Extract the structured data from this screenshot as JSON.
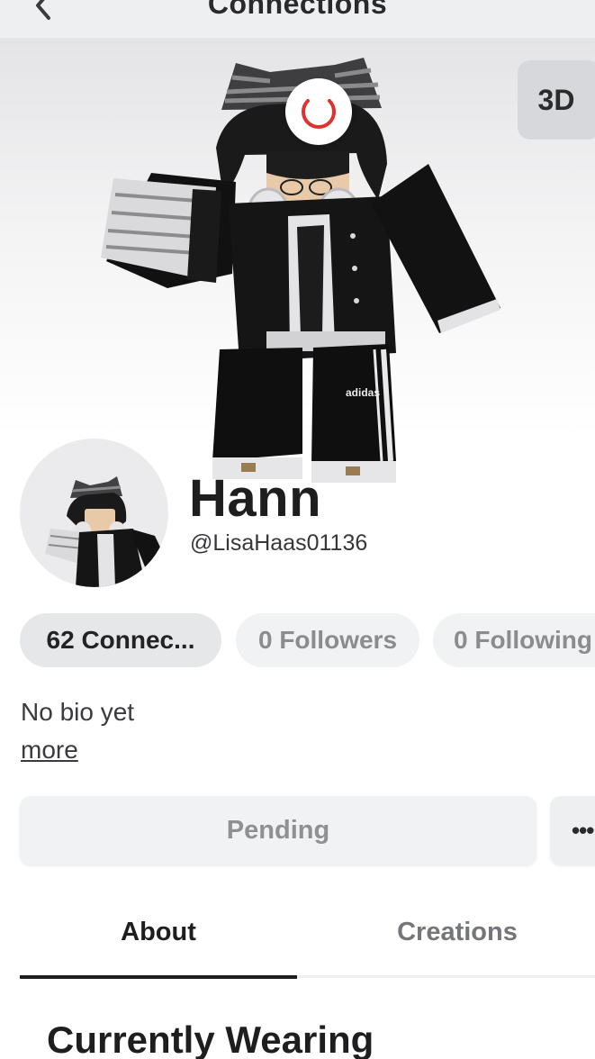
{
  "header": {
    "title": "Connections"
  },
  "stage": {
    "view_3d_label": "3D"
  },
  "profile": {
    "display_name": "Hann",
    "username": "@LisaHaas01136"
  },
  "stats": {
    "connections": "62 Connec...",
    "followers": "0 Followers",
    "following": "0 Following"
  },
  "bio": {
    "text": "No bio yet",
    "more_label": "more"
  },
  "actions": {
    "pending_label": "Pending",
    "more_label": "•••"
  },
  "tabs": [
    {
      "label": "About",
      "selected": true
    },
    {
      "label": "Creations",
      "selected": false
    }
  ],
  "section": {
    "title": "Currently Wearing"
  },
  "colors": {
    "header_bg": "#eeeff1",
    "loader_accent": "#e03131",
    "pill_active_bg": "#e6e7e9",
    "pill_bg": "#f1f2f3",
    "tab_indicator": "#1e1e20"
  }
}
